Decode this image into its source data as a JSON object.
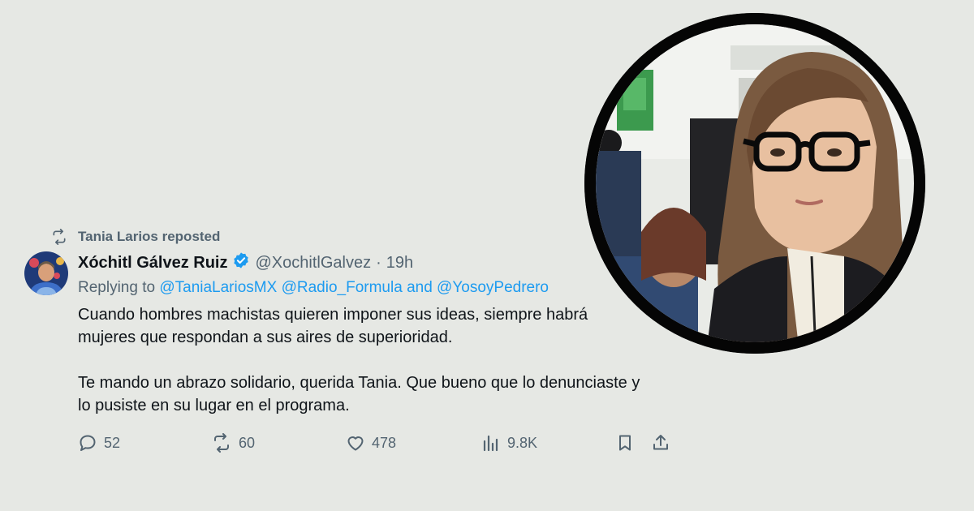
{
  "repost": {
    "label": "Tania Larios reposted",
    "icon": "repost-icon"
  },
  "author": {
    "name": "Xóchitl Gálvez Ruiz",
    "verified_icon": "verified-badge-icon",
    "handle": "@XochitlGalvez",
    "separator": "·",
    "time": "19h",
    "avatar": "avatar"
  },
  "reply": {
    "prefix": "Replying to",
    "mention1": "@TaniaLariosMX",
    "mention2": "@Radio_Formula",
    "conjunction": "and",
    "mention3": "@YosoyPedrero"
  },
  "body": {
    "paragraph1": "Cuando hombres machistas quieren imponer sus ideas, siempre habrá mujeres que respondan a sus aires de superioridad.",
    "paragraph2": "Te mando un abrazo solidario, querida Tania. Que bueno que lo denunciaste y lo pusiste en su lugar en el programa."
  },
  "actions": {
    "replies": "52",
    "reposts": "60",
    "likes": "478",
    "views": "9.8K"
  },
  "colors": {
    "background": "#e6e8e4",
    "text": "#0f1419",
    "secondary": "#536471",
    "link": "#1d9bf0",
    "verified": "#1d9bf0"
  }
}
